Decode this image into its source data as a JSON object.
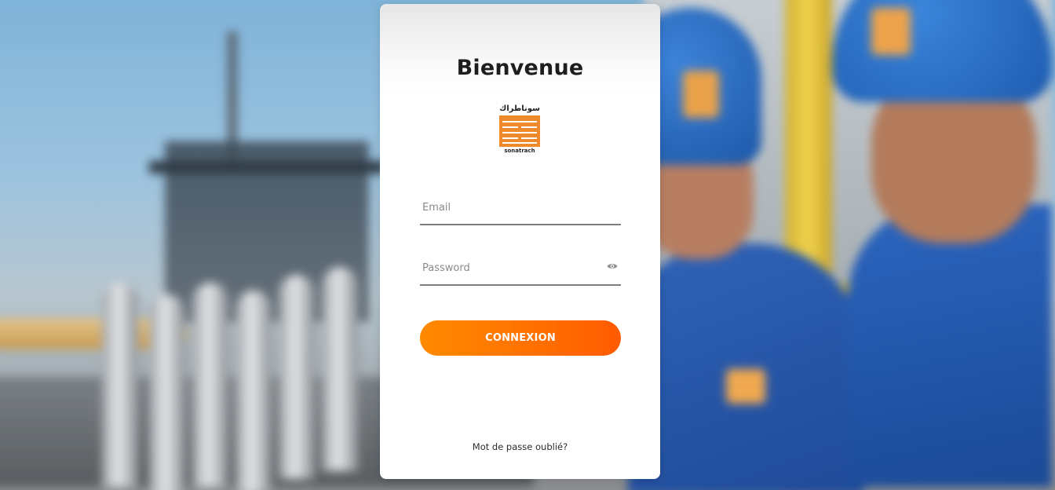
{
  "login": {
    "title": "Bienvenue",
    "logo": {
      "arabic_text": "سوناطراك",
      "latin_text": "sonatrach",
      "brand_color": "#ef8a2a"
    },
    "email": {
      "placeholder": "Email",
      "value": ""
    },
    "password": {
      "placeholder": "Password",
      "value": "",
      "toggle_icon": "eye-icon"
    },
    "submit_label": "CONNEXION",
    "forgot_label": "Mot de passe oublié?"
  },
  "colors": {
    "accent_start": "#ff8a00",
    "accent_end": "#ff5a00",
    "text_dark": "#1e1e1e",
    "underline": "#7d7d7d"
  }
}
